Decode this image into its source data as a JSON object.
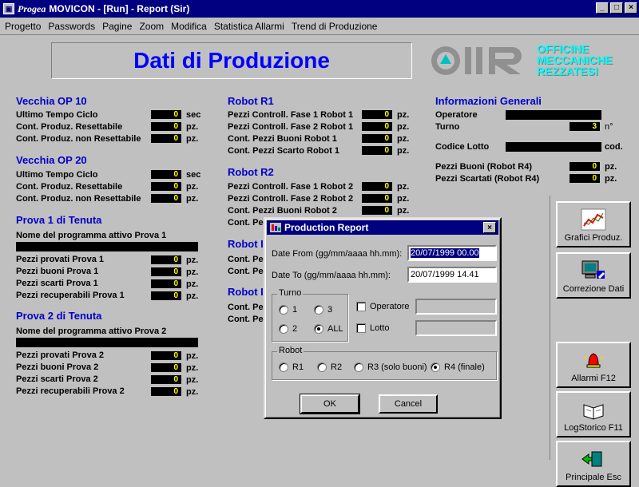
{
  "window": {
    "brand": "Progea",
    "title": "MOVICON - [Run] - Report (Sir)",
    "buttons": [
      "_",
      "□",
      "×"
    ]
  },
  "menu": [
    "Progetto",
    "Passwords",
    "Pagine",
    "Zoom",
    "Modifica",
    "Statistica Allarmi",
    "Trend di Produzione"
  ],
  "header": {
    "title": "Dati di Produzione",
    "logo_text": [
      "OFFICINE",
      "MECCANICHE",
      "REZZATESI"
    ]
  },
  "sections": {
    "op10": {
      "title": "Vecchia OP 10",
      "rows": [
        {
          "label": "Ultimo Tempo Ciclo",
          "value": "0",
          "unit": "sec"
        },
        {
          "label": "Cont. Produz. Resettabile",
          "value": "0",
          "unit": "pz."
        },
        {
          "label": "Cont. Produz. non Resettabile",
          "value": "0",
          "unit": "pz."
        }
      ]
    },
    "op20": {
      "title": "Vecchia OP 20",
      "rows": [
        {
          "label": "Ultimo Tempo Ciclo",
          "value": "0",
          "unit": "sec"
        },
        {
          "label": "Cont. Produz. Resettabile",
          "value": "0",
          "unit": "pz."
        },
        {
          "label": "Cont. Produz. non Resettabile",
          "value": "0",
          "unit": "pz."
        }
      ]
    },
    "prova1": {
      "title": "Prova 1 di Tenuta",
      "program_label": "Nome del programma attivo Prova 1",
      "rows": [
        {
          "label": "Pezzi provati Prova 1",
          "value": "0",
          "unit": "pz."
        },
        {
          "label": "Pezzi buoni Prova 1",
          "value": "0",
          "unit": "pz."
        },
        {
          "label": "Pezzi scarti Prova 1",
          "value": "0",
          "unit": "pz."
        },
        {
          "label": "Pezzi recuperabili Prova 1",
          "value": "0",
          "unit": "pz."
        }
      ]
    },
    "prova2": {
      "title": "Prova 2 di Tenuta",
      "program_label": "Nome del programma attivo Prova 2",
      "rows": [
        {
          "label": "Pezzi provati Prova 2",
          "value": "0",
          "unit": "pz."
        },
        {
          "label": "Pezzi buoni Prova 2",
          "value": "0",
          "unit": "pz."
        },
        {
          "label": "Pezzi scarti Prova 2",
          "value": "0",
          "unit": "pz."
        },
        {
          "label": "Pezzi recuperabili Prova 2",
          "value": "0",
          "unit": "pz."
        }
      ]
    },
    "r1": {
      "title": "Robot R1",
      "rows": [
        {
          "label": "Pezzi Controll. Fase 1 Robot 1",
          "value": "0",
          "unit": "pz."
        },
        {
          "label": "Pezzi Controll. Fase 2 Robot 1",
          "value": "0",
          "unit": "pz."
        },
        {
          "label": "Cont. Pezzi Buoni Robot 1",
          "value": "0",
          "unit": "pz."
        },
        {
          "label": "Cont. Pezzi Scarto Robot 1",
          "value": "0",
          "unit": "pz."
        }
      ]
    },
    "r2": {
      "title": "Robot R2",
      "rows": [
        {
          "label": "Pezzi Controll. Fase 1 Robot 2",
          "value": "0",
          "unit": "pz."
        },
        {
          "label": "Pezzi Controll. Fase 2 Robot 2",
          "value": "0",
          "unit": "pz."
        },
        {
          "label": "Cont. Pezzi Buoni Robot 2",
          "value": "0",
          "unit": "pz."
        },
        {
          "label": "Cont. Pe",
          "value": "",
          "unit": ""
        }
      ]
    },
    "r3": {
      "title": "Robot I",
      "rows": [
        {
          "label": "Cont. Pe"
        },
        {
          "label": "Cont. Pe"
        }
      ]
    },
    "r4": {
      "title": "Robot I",
      "rows": [
        {
          "label": "Cont. Pe"
        },
        {
          "label": "Cont. Pe"
        }
      ]
    },
    "info": {
      "title": "Informazioni Generali",
      "operatore_label": "Operatore",
      "turno_label": "Turno",
      "turno_value": "3",
      "turno_unit": "n°",
      "lotto_label": "Codice Lotto",
      "lotto_unit": "cod.",
      "buoni_label": "Pezzi Buoni (Robot R4)",
      "buoni_value": "0",
      "buoni_unit": "pz.",
      "scartati_label": "Pezzi Scartati (Robot R4)",
      "scartati_value": "0",
      "scartati_unit": "pz."
    }
  },
  "side_buttons": [
    {
      "label": "Grafici Produz.",
      "icon": "chart-icon"
    },
    {
      "label": "Correzione Dati",
      "icon": "computer-edit-icon"
    },
    {
      "label": "Allarmi F12",
      "icon": "alarm-bell-icon"
    },
    {
      "label": "LogStorico F11",
      "icon": "book-icon"
    },
    {
      "label": "Principale Esc",
      "icon": "exit-door-icon"
    }
  ],
  "dialog": {
    "title": "Production Report",
    "date_from_label": "Date From (gg/mm/aaaa hh.mm):",
    "date_from_value": "20/07/1999 00.00",
    "date_to_label": "Date To (gg/mm/aaaa hh.mm):",
    "date_to_value": "20/07/1999 14.41",
    "turno_group": "Turno",
    "turno_options": [
      "1",
      "3",
      "2",
      "ALL"
    ],
    "turno_selected": "ALL",
    "operatore_label": "Operatore",
    "lotto_label": "Lotto",
    "robot_group": "Robot",
    "robot_options": [
      "R1",
      "R2",
      "R3 (solo buoni)",
      "R4 (finale)"
    ],
    "robot_selected": "R4 (finale)",
    "ok_label": "OK",
    "cancel_label": "Cancel"
  }
}
